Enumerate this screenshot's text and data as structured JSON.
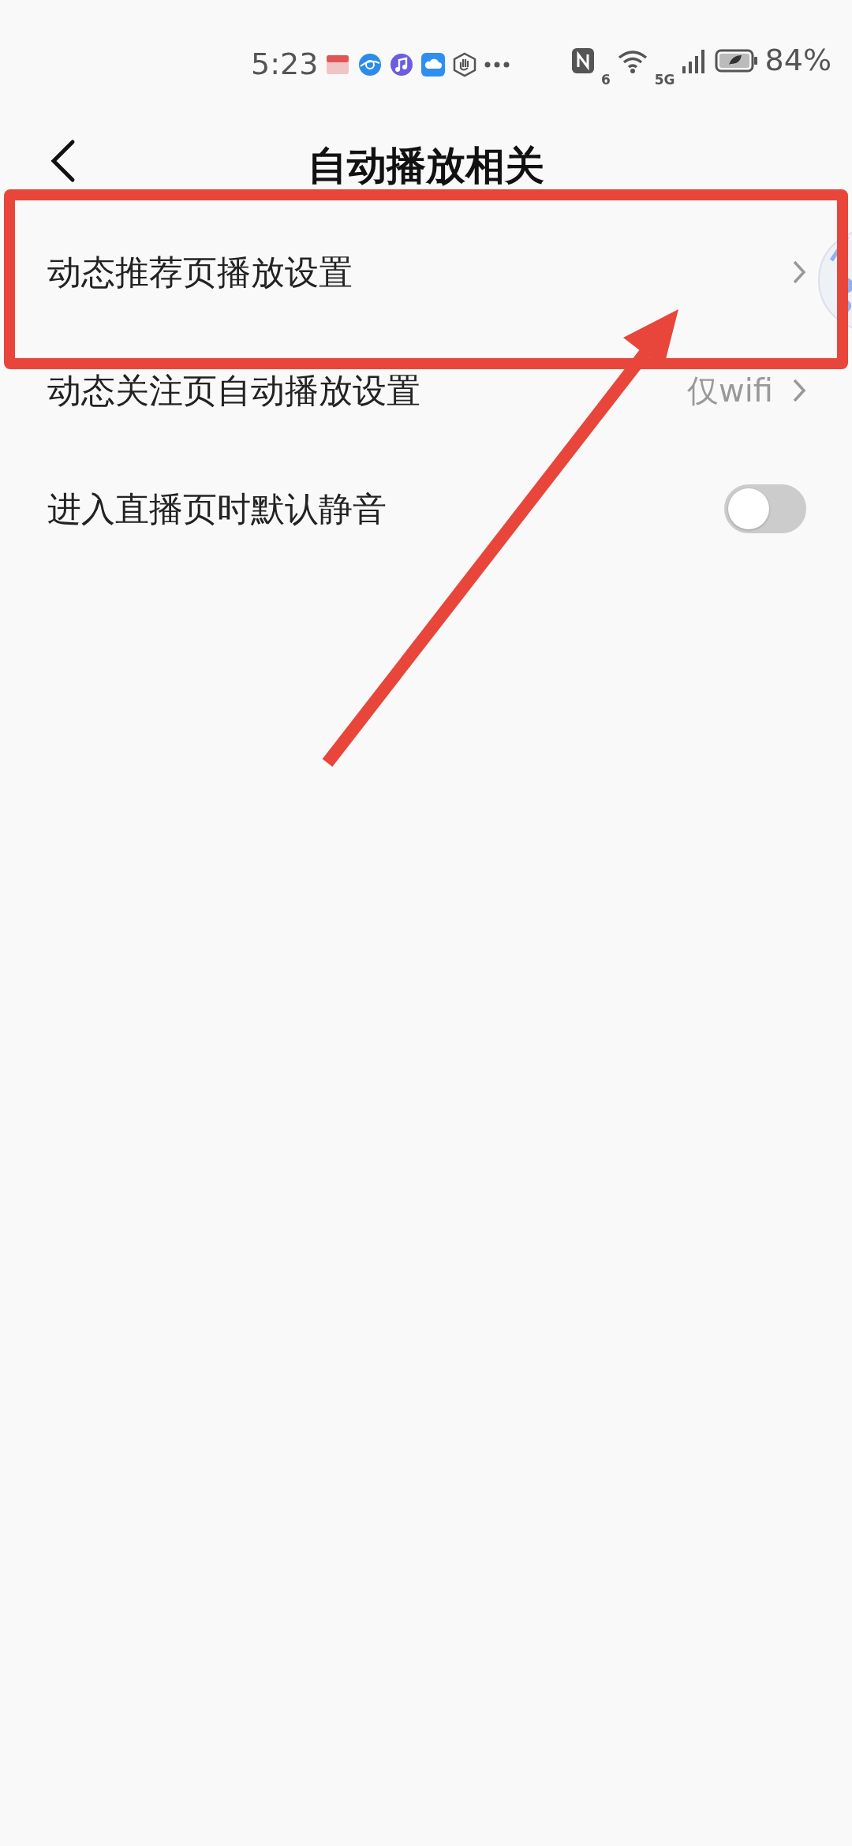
{
  "status_bar": {
    "time": "5:23",
    "wifi_generation": "6",
    "network": "5G",
    "battery": "84%"
  },
  "header": {
    "title": "自动播放相关"
  },
  "settings": [
    {
      "kind": "link",
      "label": "动态推荐页播放设置",
      "highlighted": true
    },
    {
      "kind": "link",
      "label": "动态关注页自动播放设置",
      "value": "仅wifi",
      "highlighted": false
    },
    {
      "kind": "toggle",
      "label": "进入直播页时默认静音",
      "on": false,
      "highlighted": false
    }
  ]
}
